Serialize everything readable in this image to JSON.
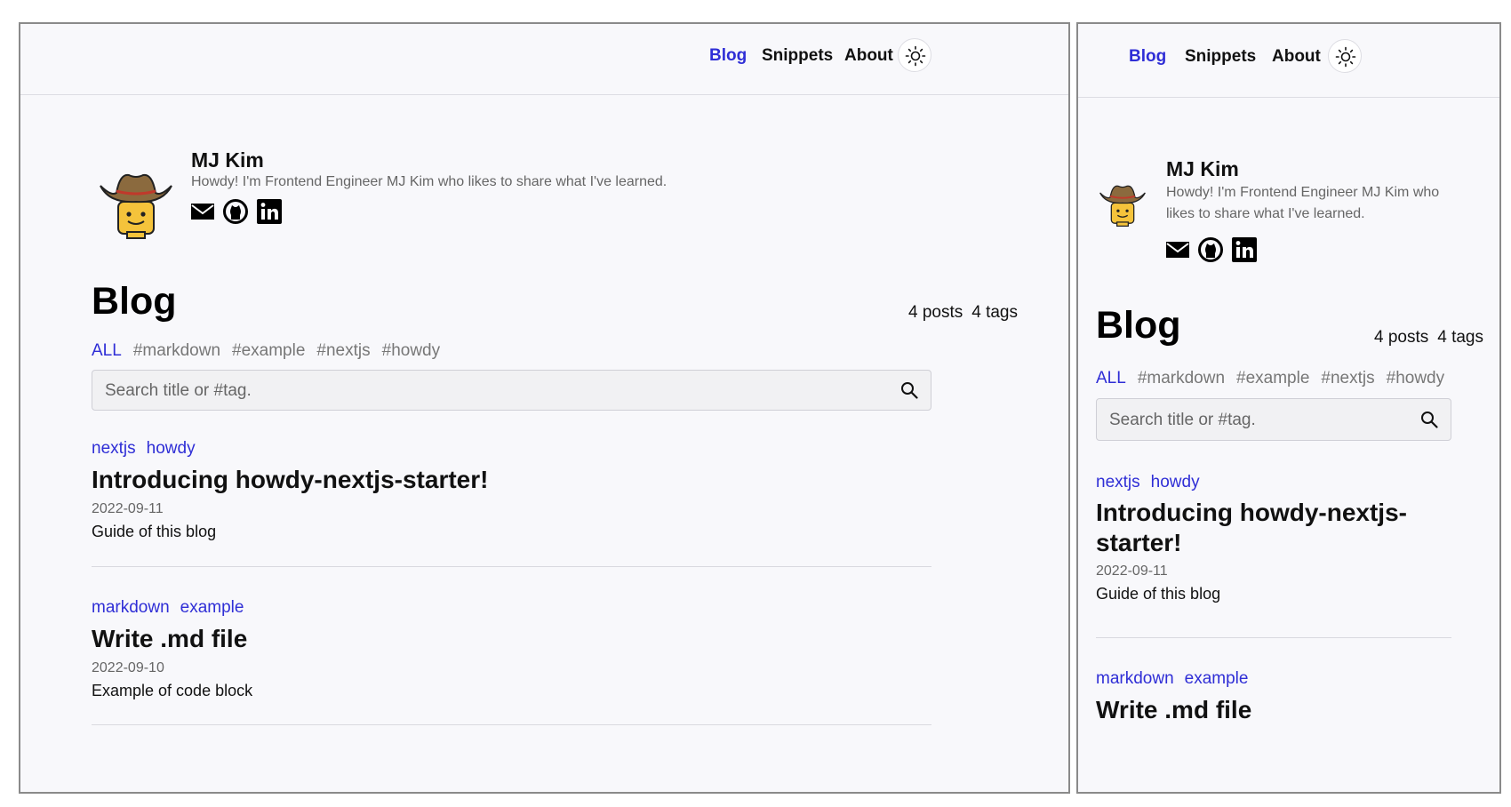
{
  "nav": {
    "links": [
      "Blog",
      "Snippets",
      "About"
    ],
    "active": "Blog",
    "theme_icon": "sun-icon"
  },
  "profile": {
    "name": "MJ Kim",
    "bio": "Howdy! I'm Frontend Engineer MJ Kim who likes to share what I've learned.",
    "bio_mobile_line1": "Howdy! I'm Frontend Engineer MJ Kim who",
    "bio_mobile_line2": "likes to share what I've learned.",
    "socials": [
      "mail-icon",
      "github-icon",
      "linkedin-icon"
    ],
    "avatar": "cowboy-avatar"
  },
  "blog": {
    "title": "Blog",
    "posts_count": "4 posts",
    "tags_count": "4 tags",
    "tags": [
      "ALL",
      "#markdown",
      "#example",
      "#nextjs",
      "#howdy"
    ],
    "search_placeholder": "Search title or #tag."
  },
  "posts": [
    {
      "tags": [
        "nextjs",
        "howdy"
      ],
      "title": "Introducing howdy-nextjs-starter!",
      "title_mobile_line1": "Introducing howdy-nextjs-",
      "title_mobile_line2": "starter!",
      "date": "2022-09-11",
      "description": "Guide of this blog"
    },
    {
      "tags": [
        "markdown",
        "example"
      ],
      "title": "Write .md file",
      "date": "2022-09-10",
      "description": "Example of code block"
    }
  ],
  "colors": {
    "accent": "#2f2ed6",
    "background": "#f8f8fb",
    "muted": "#666666"
  }
}
